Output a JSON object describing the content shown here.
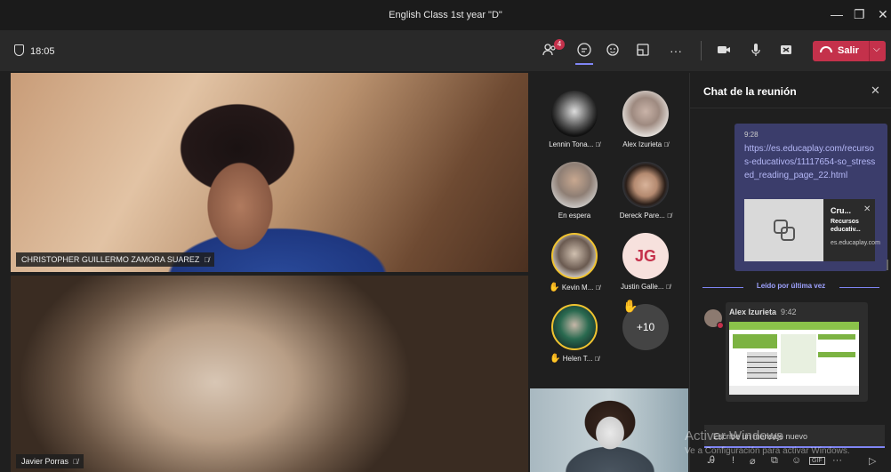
{
  "window": {
    "title": "English Class 1st year \"D\"",
    "minimize": "—",
    "maximize": "❐",
    "close": "✕"
  },
  "toolbar": {
    "timer": "18:05",
    "participants_badge": "4",
    "leave_label": "Salir",
    "leave_color": "#c4314b",
    "icons": [
      "participants-icon",
      "chat-icon",
      "reactions-icon",
      "rooms-icon",
      "more-icon",
      "camera-icon",
      "mic-icon",
      "share-icon",
      "phone-icon"
    ],
    "more": "···"
  },
  "videos": {
    "main_top_label": "CHRISTOPHER GUILLERMO ZAMORA SUAREZ",
    "main_bottom_label": "Javier Porras"
  },
  "gallery": {
    "participants": [
      {
        "name": "Lennin Tona...",
        "muted": true
      },
      {
        "name": "Alex Izurieta",
        "muted": true
      },
      {
        "name": "En espera",
        "muted": false
      },
      {
        "name": "Dereck Pare...",
        "muted": true
      },
      {
        "name": "Kevin M...",
        "muted": true,
        "hand": true
      },
      {
        "name": "Justin Galle...",
        "muted": true,
        "initials": "JG"
      },
      {
        "name": "Helen T...",
        "muted": true,
        "hand": true
      },
      {
        "overflow": "+10",
        "hand": true
      }
    ]
  },
  "chat": {
    "title": "Chat de la reunión",
    "message1": {
      "time": "9:28",
      "link": "https://es.educaplay.com/recursos-educativos/11117654-so_stressed_reading_page_22.html",
      "preview_title": "Cru...",
      "preview_desc": "Recursos educativ...",
      "preview_domain": "es.educaplay.com"
    },
    "seen_label": "Leído por última vez",
    "message2": {
      "sender": "Alex Izurieta",
      "time": "9:42"
    },
    "compose_placeholder": "Escribe un mensaje nuevo"
  },
  "watermark": {
    "line1": "Activar Windows",
    "line2": "Ve a Configuración para activar Windows."
  },
  "colors": {
    "accent": "#7f85f5",
    "raise_hand": "#f0b330",
    "bubble": "#3b3d6b"
  }
}
